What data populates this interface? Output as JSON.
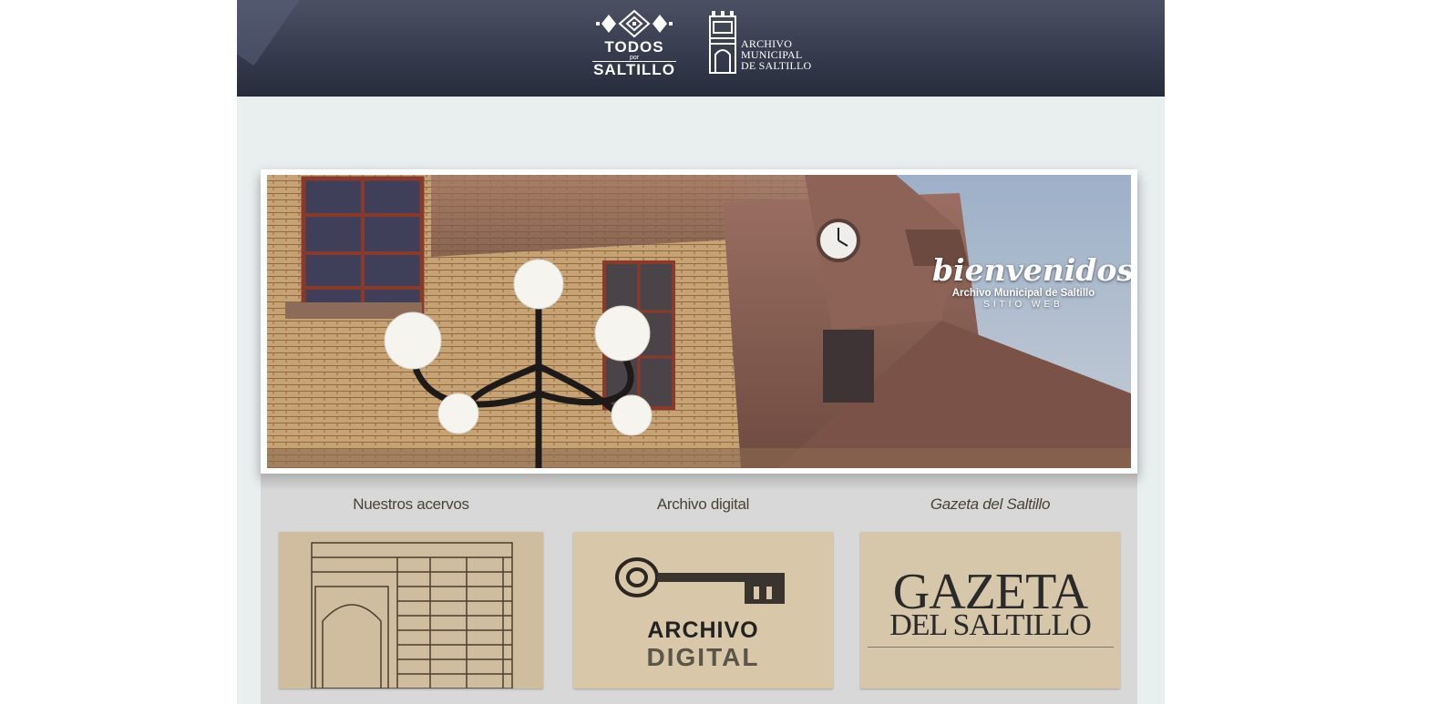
{
  "header": {
    "logo_todos": {
      "line1": "TODOS",
      "line2": "por",
      "line3": "SALTILLO"
    },
    "logo_archivo": {
      "line1": "ARCHIVO",
      "line2": "MUNICIPAL",
      "line3": "DE SALTILLO"
    }
  },
  "banner": {
    "title": "bienvenidos",
    "subtitle": "Archivo Municipal de Saltillo",
    "tagline": "SITIO WEB"
  },
  "sections": [
    {
      "title": "Nuestros acervos",
      "italic": false
    },
    {
      "title": "Archivo digital",
      "italic": false,
      "card_line1": "ARCHIVO",
      "card_line2": "DIGITAL"
    },
    {
      "title": "Gazeta del Saltillo",
      "italic": true,
      "card_line1": "GAZETA",
      "card_line2": "DEL SALTILLO"
    }
  ],
  "colors": {
    "header_dark": "#262c3b",
    "page_bg": "#e9eeef",
    "sections_bg": "#d8d8d8",
    "section_title": "#4a4335"
  }
}
